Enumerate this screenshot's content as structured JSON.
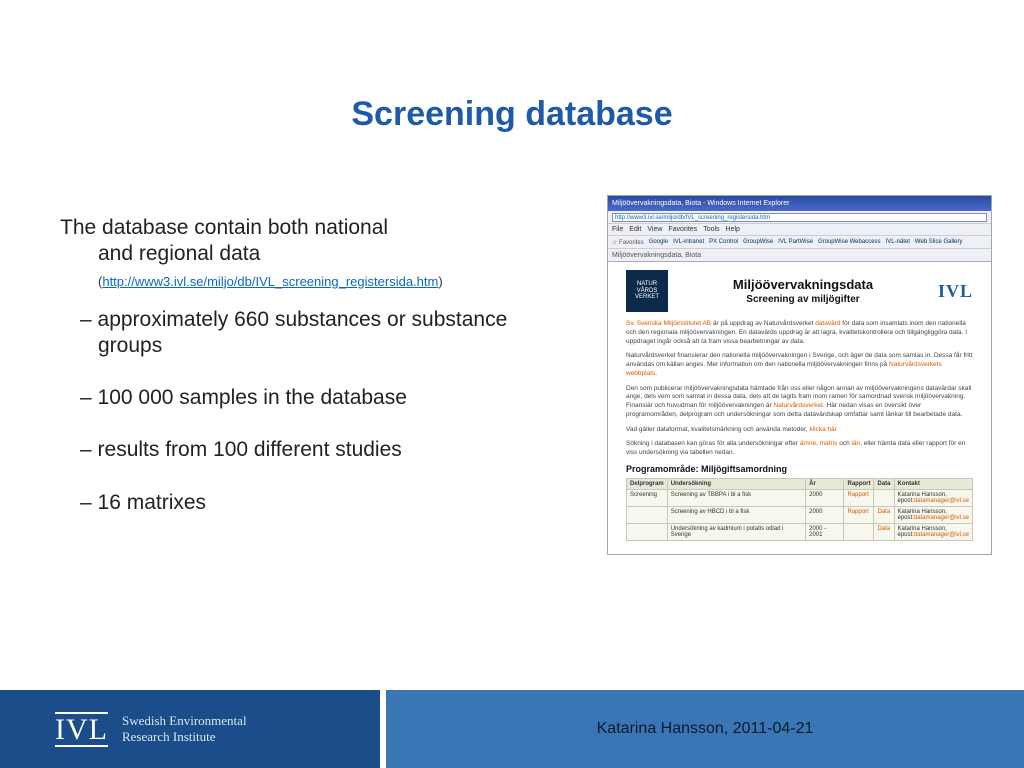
{
  "title": "Screening database",
  "intro": {
    "line1": "The database contain both national",
    "line2": "and regional data",
    "url": "http://www3.ivl.se/miljo/db/IVL_screening_registersida.htm"
  },
  "bullets": [
    "approximately 660 substances or substance groups",
    "100 000 samples in the database",
    "results from 100 different studies",
    "16 matrixes"
  ],
  "screenshot": {
    "window_title": "Miljöövervakningsdata, Biota - Windows Internet Explorer",
    "address": "http://www3.ivl.se/miljo/db/IVL_screening_registersida.htm",
    "menu": [
      "File",
      "Edit",
      "View",
      "Favorites",
      "Tools",
      "Help"
    ],
    "favorites": [
      "Favorites",
      "Google",
      "IVL-intranet",
      "PX Control",
      "GroupWise",
      "IVL PartWise",
      "GroupWise Webaccess",
      "IVL-nätet",
      "Web Slice Gallery"
    ],
    "tab": "Miljöövervakningsdata, Biota",
    "nv_badge": [
      "NATUR",
      "VÅRDS",
      "VERKET"
    ],
    "h1": "Miljöövervakningsdata",
    "h2": "Screening av miljögifter",
    "ivl_mini": "IVL",
    "p1_a": "Sv. Svenska Miljöinstitutet AB",
    "p1_b": " är på uppdrag av Naturvårdsverket ",
    "p1_c": "datavärd",
    "p1_d": " för data som insamlats inom den nationella och den regionala miljöövervakningen. En datavärds uppdrag är att lagra, kvalitetskontrollera och tillgängliggöra data. I uppdraget ingår också att ta fram vissa bearbetningar av data.",
    "p2_a": "Naturvårdsverket finansierar den nationella miljöövervakningen i Sverige, och äger de data som samlas in. Dessa får fritt användas om källan anges. Mer information om den nationella miljöövervakningen finns på ",
    "p2_b": "Naturvårdsverkets webbplats",
    "p2_c": ".",
    "p3_a": "Den som publicerar miljöövervakningsdata hämtade från oss eller någon annan av miljöövervakningens datavärdar skall ange, dels vem som samlat in dessa data, dels att de tagits fram inom ramen för samordnad svensk miljöövervakning. Finansiär och huvudman för miljöövervakningen är ",
    "p3_b": "Naturvårdsverket",
    "p3_c": ". Här nedan visas en översikt över programområden, delprogram och undersökningar som detta datavärdskap omfattar samt länkar till bearbetade data.",
    "p4_a": "Vad gäller dataformat, kvalitetsmärkning och använda metoder, ",
    "p4_b": "klicka här",
    "p5_a": "Sökning i databasen kan göras för alla undersökningar efter ",
    "p5_b": "ämne",
    "p5_c": ", ",
    "p5_d": "matris",
    "p5_e": " och ",
    "p5_f": "län",
    "p5_g": ", eller hämta data eller rapport för en viss undersökning via tabellen nedan.",
    "subheading": "Programområde: Miljögiftsamordning",
    "table": {
      "headers": [
        "Delprogram",
        "Undersökning",
        "År",
        "Rapport",
        "Data",
        "Kontakt"
      ],
      "rows": [
        {
          "dp": "Screening",
          "und": "Screening av TBBPA i bl a fisk",
          "ar": "2000",
          "rap": "Rapport",
          "dat": "",
          "kon_n": "Katarina Hansson,",
          "kon_e": "epost:",
          "kon_m": "datamanager@ivl.se"
        },
        {
          "dp": "",
          "und": "Screening av HBCD i bl a fisk",
          "ar": "2000",
          "rap": "Rapport",
          "dat": "Data",
          "kon_n": "Katarina Hansson,",
          "kon_e": "epost:",
          "kon_m": "datamanager@ivl.se"
        },
        {
          "dp": "",
          "und": "Undersökning av kadmium i potatis odlad i Sverige",
          "ar": "2000 - 2001",
          "rap": "",
          "dat": "Data",
          "kon_n": "Katarina Hansson,",
          "kon_e": "epost:",
          "kon_m": "datamanager@ivl.se"
        }
      ]
    }
  },
  "footer": {
    "logo": "IVL",
    "org1": "Swedish Environmental",
    "org2": "Research Institute",
    "author_date": "Katarina Hansson, 2011-04-21"
  }
}
